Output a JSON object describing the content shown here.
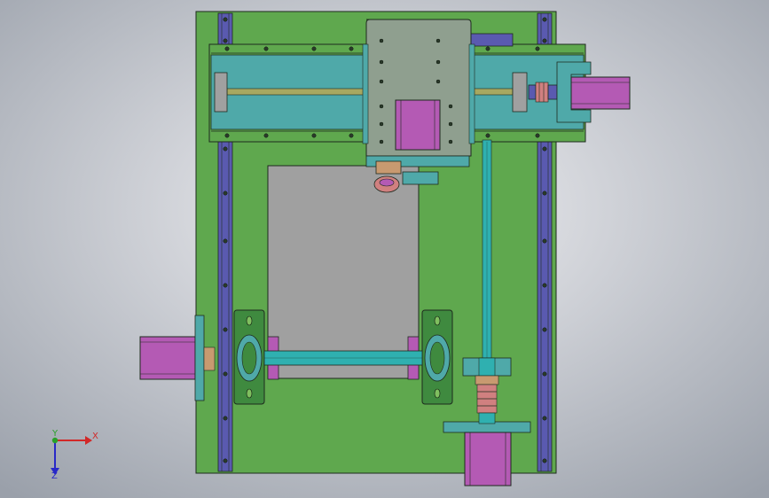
{
  "viewport": {
    "background_center": "#f2f2f5",
    "background_edge": "#9aa0aa"
  },
  "colors": {
    "frame_green": "#5fa84e",
    "rail_blue": "#5a5ab0",
    "rail_cyan": "#4fa9a9",
    "plate_gray": "#a0a0a0",
    "motor_magenta": "#b45ab4",
    "shaft_cyan": "#2fb0b0",
    "screw_yellow": "#a8a860",
    "bearing_green": "#3f8a3f",
    "coupling_pink": "#d08080",
    "coupling_tan": "#c89a70",
    "carriage_gray": "#8f9f8f",
    "outline": "#1e2a1e"
  },
  "axis_triad": {
    "x_label": "X",
    "y_label": "Y",
    "z_label": "Z",
    "x_color": "#d22828",
    "y_color": "#28a028",
    "z_color": "#2828c8"
  }
}
